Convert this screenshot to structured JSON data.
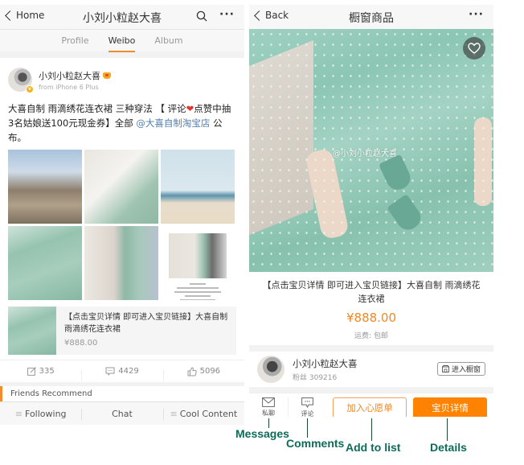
{
  "left": {
    "nav": {
      "back_label": "Home",
      "title": "小刘小粒赵大喜",
      "search_icon": "search-icon",
      "more_label": "···"
    },
    "tabs": [
      {
        "label": "Profile",
        "active": false
      },
      {
        "label": "Weibo",
        "active": true
      },
      {
        "label": "Album",
        "active": false
      }
    ],
    "post": {
      "author": "小刘小粒赵大喜",
      "source": "from iPhone 6 Plus",
      "text_before": "大喜自制 雨滴绣花连衣裙  三种穿法 【 评论",
      "heart": "❤",
      "text_middle": "点赞中抽3名姑娘送100元现金券】全部 ",
      "link": "@大喜自制淘宝店",
      "text_after": " 公布。",
      "goods": {
        "title": "【点击宝贝详情 即可进入宝贝链接】大喜自制 雨滴绣花连衣裙",
        "price": "¥888.00"
      },
      "stats": {
        "reposts": "335",
        "comments": "4429",
        "likes": "5096"
      }
    },
    "friends_recommend": "Friends Recommend",
    "bottom_tabs": [
      {
        "label": "Following"
      },
      {
        "label": "Chat"
      },
      {
        "label": "Cool Content"
      }
    ]
  },
  "right": {
    "nav": {
      "back_label": "Back",
      "title": "橱窗商品",
      "more_label": "···"
    },
    "product": {
      "watermark": "@小刘小粒赵大喜",
      "title": "【点击宝贝详情 即可进入宝贝链接】大喜自制 雨滴绣花连衣裙",
      "price": "¥888.00",
      "shipping": "运费: 包邮"
    },
    "seller": {
      "name": "小刘小粒赵大喜",
      "fans": "粉丝 309216",
      "shop_button": "进入橱窗"
    },
    "bottom": {
      "message_label": "私聊",
      "comment_label": "评论",
      "wishlist_label": "加入心愿单",
      "details_label": "宝贝详情"
    }
  },
  "annotations": {
    "messages": "Messages",
    "comments": "Comments",
    "add_to_list": "Add to list",
    "details": "Details"
  },
  "colors": {
    "accent_orange": "#ff8200",
    "price_orange": "#f5871f",
    "link_blue": "#507daf",
    "annotation_green": "#0e6b5a"
  }
}
